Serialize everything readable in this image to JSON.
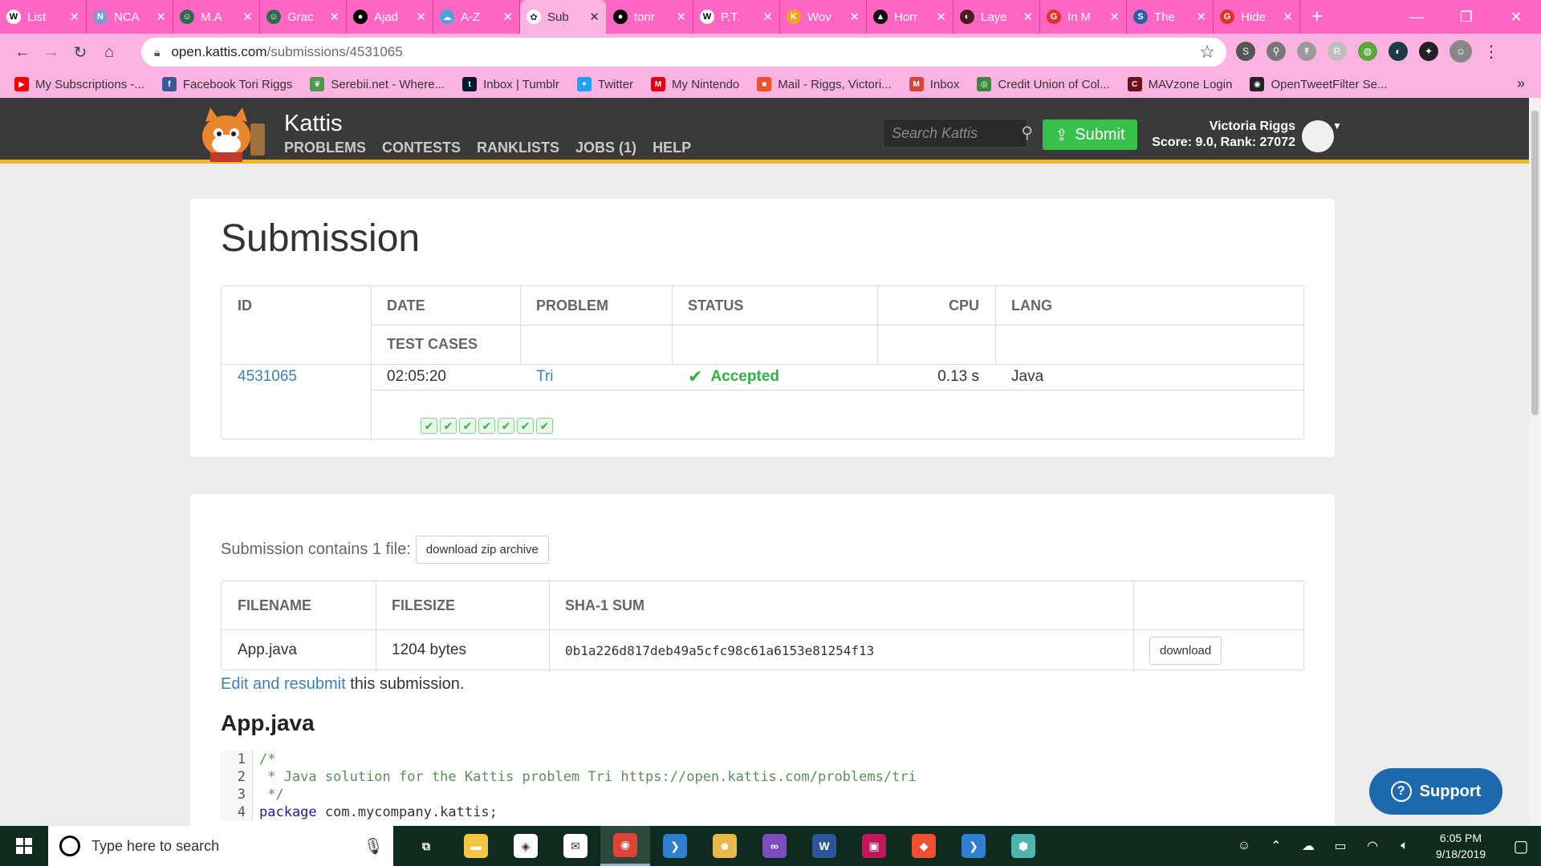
{
  "browser": {
    "tabs": [
      {
        "title": "List",
        "icon": "W",
        "icon_bg": "#ffffff",
        "icon_fg": "#000000"
      },
      {
        "title": "NCA",
        "icon": "N",
        "icon_bg": "#7a9bd6",
        "icon_fg": "#ffffff"
      },
      {
        "title": "M.A",
        "icon": "☺",
        "icon_bg": "#2e6b4a",
        "icon_fg": "#ffffff"
      },
      {
        "title": "Grac",
        "icon": "☺",
        "icon_bg": "#2e6b4a",
        "icon_fg": "#ffffff"
      },
      {
        "title": "Ajad",
        "icon": "●",
        "icon_bg": "#000000",
        "icon_fg": "#ffffff"
      },
      {
        "title": "A-Z",
        "icon": "☁",
        "icon_bg": "#4aa3df",
        "icon_fg": "#ffffff"
      },
      {
        "title": "Sub",
        "icon": "✿",
        "icon_bg": "#ffffff",
        "icon_fg": "#333333"
      },
      {
        "title": "torir",
        "icon": "●",
        "icon_bg": "#000000",
        "icon_fg": "#ffffff"
      },
      {
        "title": "P.T.",
        "icon": "W",
        "icon_bg": "#ffffff",
        "icon_fg": "#000000"
      },
      {
        "title": "Wov",
        "icon": "K",
        "icon_bg": "#f2a51c",
        "icon_fg": "#ffffff"
      },
      {
        "title": "Horr",
        "icon": "▲",
        "icon_bg": "#111111",
        "icon_fg": "#ffffff"
      },
      {
        "title": "Laye",
        "icon": "◐",
        "icon_bg": "#4a1c1c",
        "icon_fg": "#ffffff"
      },
      {
        "title": "In M",
        "icon": "G",
        "icon_bg": "#e0342a",
        "icon_fg": "#ffffff"
      },
      {
        "title": "The",
        "icon": "S",
        "icon_bg": "#2a5ea8",
        "icon_fg": "#ffffff"
      },
      {
        "title": "Hide",
        "icon": "G",
        "icon_bg": "#e0342a",
        "icon_fg": "#ffffff"
      }
    ],
    "active_tab_index": 6,
    "url_host": "open.kattis.com",
    "url_path": "/submissions/4531065",
    "bookmarks": [
      {
        "label": "My Subscriptions -...",
        "icon": "▶",
        "color": "#ff0000"
      },
      {
        "label": "Facebook  Tori Riggs",
        "icon": "f",
        "color": "#3b5998"
      },
      {
        "label": "Serebii.net - Where...",
        "icon": "❦",
        "color": "#4a9a4a"
      },
      {
        "label": "Inbox | Tumblr",
        "icon": "t",
        "color": "#001935"
      },
      {
        "label": "Twitter",
        "icon": "✦",
        "color": "#1da1f2"
      },
      {
        "label": "My Nintendo",
        "icon": "M",
        "color": "#e60012"
      },
      {
        "label": "Mail - Riggs, Victori...",
        "icon": "■",
        "color": "#f25022"
      },
      {
        "label": "Inbox",
        "icon": "M",
        "color": "#d44638"
      },
      {
        "label": "Credit Union of Col...",
        "icon": "◎",
        "color": "#3a8a3a"
      },
      {
        "label": "MAVzone Login",
        "icon": "C",
        "color": "#6b0f1a"
      },
      {
        "label": "OpenTweetFilter Se...",
        "icon": "◉",
        "color": "#222222"
      }
    ],
    "more_bookmarks": "»"
  },
  "kattis": {
    "brand": "Kattis",
    "nav": [
      "PROBLEMS",
      "CONTESTS",
      "RANKLISTS",
      "JOBS (1)",
      "HELP"
    ],
    "search_placeholder": "Search Kattis",
    "submit_label": "Submit",
    "user_name": "Victoria Riggs",
    "user_score": "Score: 9.0, Rank: 27072"
  },
  "submission": {
    "title": "Submission",
    "headers": {
      "id": "ID",
      "date": "DATE",
      "problem": "PROBLEM",
      "status": "STATUS",
      "cpu": "CPU",
      "lang": "LANG",
      "test_cases": "TEST CASES"
    },
    "row": {
      "id": "4531065",
      "date": "02:05:20",
      "problem": "Tri",
      "status": "Accepted",
      "cpu": "0.13 s",
      "lang": "Java"
    },
    "test_cases_passed": 7
  },
  "files": {
    "contains_text": "Submission contains 1 file:",
    "download_zip_label": "download zip archive",
    "headers": {
      "filename": "FILENAME",
      "filesize": "FILESIZE",
      "sha1": "SHA-1 SUM"
    },
    "row": {
      "filename": "App.java",
      "filesize": "1204 bytes",
      "sha1": "0b1a226d817deb49a5cfc98c61a6153e81254f13",
      "download_label": "download"
    },
    "edit_link": "Edit and resubmit",
    "edit_suffix": " this submission.",
    "file_heading": "App.java",
    "code_lines": [
      {
        "n": "1",
        "text": "/*",
        "kind": "comment"
      },
      {
        "n": "2",
        "text": " * Java solution for the Kattis problem Tri https://open.kattis.com/problems/tri",
        "kind": "comment"
      },
      {
        "n": "3",
        "text": " */",
        "kind": "comment"
      },
      {
        "n": "4",
        "kw": "package",
        "text": " com.mycompany.kattis;",
        "kind": "code"
      }
    ]
  },
  "support_label": "Support",
  "taskbar": {
    "search_placeholder": "Type here to search",
    "apps": [
      {
        "name": "task-view",
        "glyph": "⧉",
        "color": "#0f2a1e"
      },
      {
        "name": "file-explorer",
        "glyph": "▬",
        "color": "#f4c542"
      },
      {
        "name": "store",
        "glyph": "◈",
        "color": "#ffffff"
      },
      {
        "name": "mail",
        "glyph": "✉",
        "color": "#ffffff"
      },
      {
        "name": "chrome",
        "glyph": "◉",
        "color": "#db4437"
      },
      {
        "name": "vscode",
        "glyph": "❯",
        "color": "#2f80d1"
      },
      {
        "name": "game",
        "glyph": "☻",
        "color": "#e8b84a"
      },
      {
        "name": "visual-studio",
        "glyph": "∞",
        "color": "#7d4cbf"
      },
      {
        "name": "word",
        "glyph": "W",
        "color": "#2b579a"
      },
      {
        "name": "media",
        "glyph": "▣",
        "color": "#c2185b"
      },
      {
        "name": "git",
        "glyph": "◆",
        "color": "#f05032"
      },
      {
        "name": "vscode-2",
        "glyph": "❯",
        "color": "#2f80d1"
      },
      {
        "name": "app-cube",
        "glyph": "⬢",
        "color": "#4db6ac"
      }
    ],
    "time": "6:05 PM",
    "date": "9/18/2019"
  }
}
